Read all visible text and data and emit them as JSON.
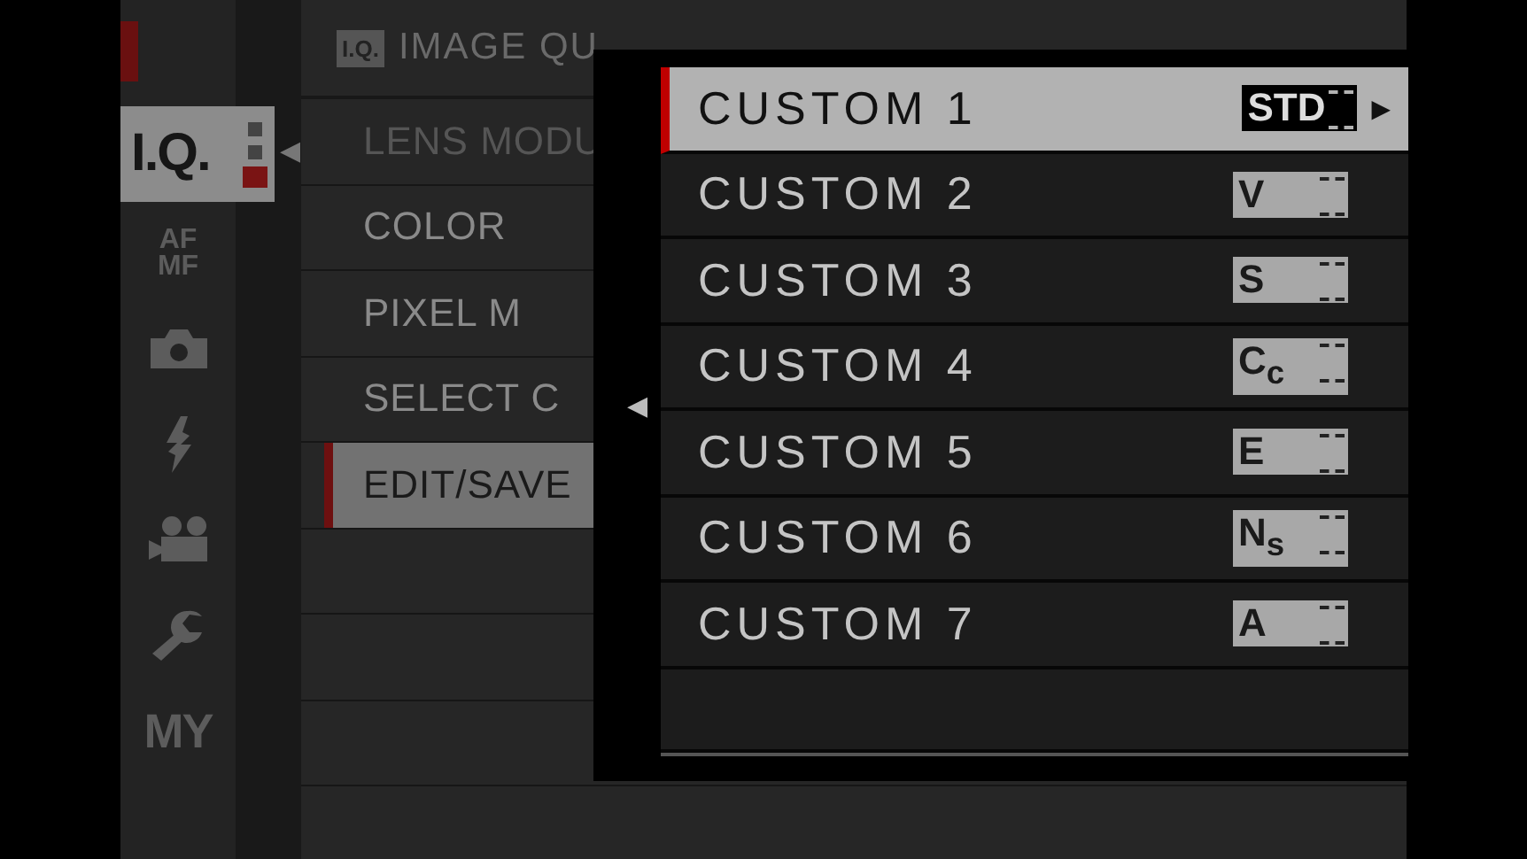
{
  "sidebar": {
    "pointer": "◀",
    "items": [
      {
        "kind": "text",
        "label": "I.Q.",
        "selected": true
      },
      {
        "kind": "stack",
        "label": "AF",
        "label_2": "MF",
        "selected": false
      },
      {
        "kind": "camera",
        "selected": false
      },
      {
        "kind": "flash",
        "selected": false
      },
      {
        "kind": "movie",
        "selected": false
      },
      {
        "kind": "wrench",
        "selected": false
      },
      {
        "kind": "text",
        "label": "MY",
        "selected": false
      }
    ]
  },
  "header": {
    "badge": "I.Q.",
    "title": "IMAGE QU"
  },
  "menu": {
    "items": [
      {
        "label": "LENS MODU",
        "disabled": true,
        "selected": false
      },
      {
        "label": "COLOR",
        "disabled": false,
        "selected": false
      },
      {
        "label": "PIXEL M",
        "disabled": false,
        "selected": false
      },
      {
        "label": "SELECT C",
        "disabled": false,
        "selected": false
      },
      {
        "label": "EDIT/SAVE",
        "disabled": false,
        "selected": true
      }
    ]
  },
  "popup": {
    "pointer": "◀",
    "items": [
      {
        "label": "CUSTOM 1",
        "badge": "STD",
        "arrow": "▶",
        "selected": true
      },
      {
        "label": "CUSTOM 2",
        "badge": "V",
        "selected": false
      },
      {
        "label": "CUSTOM 3",
        "badge": "S",
        "selected": false
      },
      {
        "label": "CUSTOM 4",
        "badge": "C$_{c}$",
        "selected": false
      },
      {
        "label": "CUSTOM 5",
        "badge": "E",
        "selected": false
      },
      {
        "label": "CUSTOM 6",
        "badge": "N$_{s}$",
        "selected": false
      },
      {
        "label": "CUSTOM 7",
        "badge": "A",
        "selected": false
      }
    ]
  }
}
